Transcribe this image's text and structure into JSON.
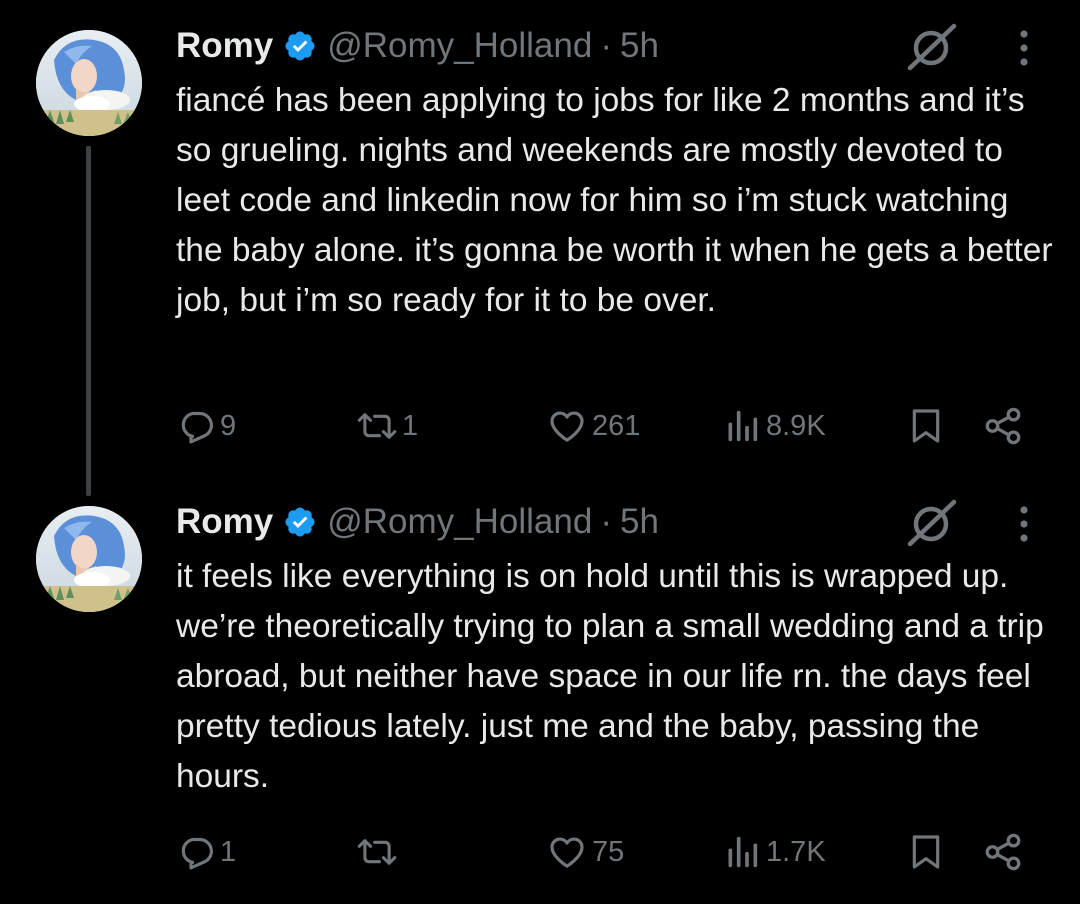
{
  "colors": {
    "background": "#000000",
    "text_primary": "#e7e9ea",
    "text_secondary": "#71767b",
    "verified_badge": "#1d9bf0",
    "thread_line": "#3e4144"
  },
  "tweets": [
    {
      "display_name": "Romy",
      "verified_icon": "verified-badge-icon",
      "handle": "@Romy_Holland",
      "separator": "·",
      "time": "5h",
      "text": "fiancé has been applying to jobs for like 2 months and it’s so grueling. nights and weekends are mostly devoted to leet code and linkedin now for him so i’m stuck watching the baby alone. it’s gonna be worth it when he gets a better job, but i’m so ready for it to be over.",
      "actions": {
        "replies": "9",
        "reposts": "1",
        "likes": "261",
        "views": "8.9K"
      }
    },
    {
      "display_name": "Romy",
      "verified_icon": "verified-badge-icon",
      "handle": "@Romy_Holland",
      "separator": "·",
      "time": "5h",
      "text": "it feels like everything is on hold until this is wrapped up. we’re theoretically trying to plan a small wedding and a trip abroad, but neither have space in our life rn. the days feel pretty tedious lately. just me and the baby, passing the hours.",
      "actions": {
        "replies": "1",
        "reposts": "",
        "likes": "75",
        "views": "1.7K"
      }
    }
  ]
}
